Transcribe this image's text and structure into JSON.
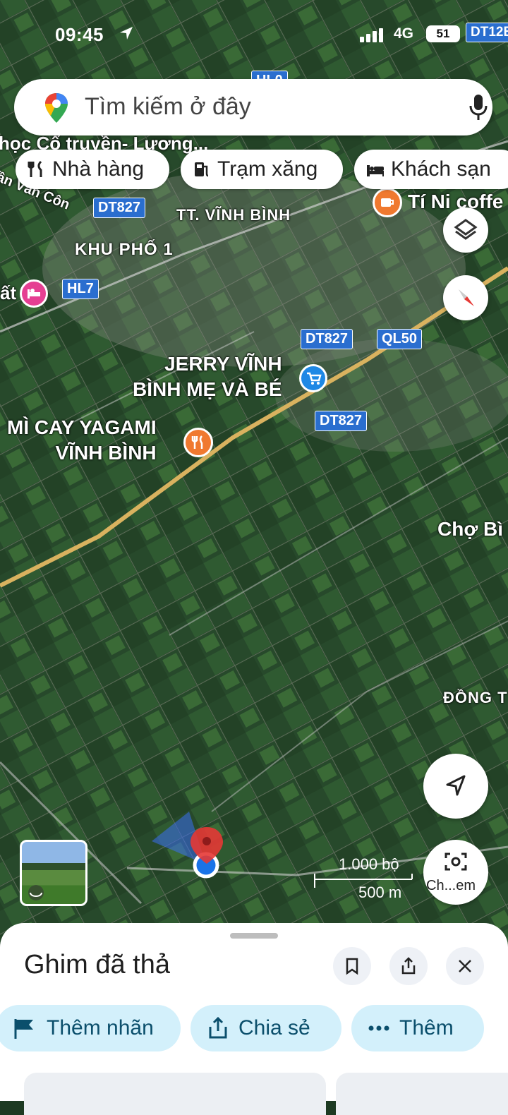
{
  "status_bar": {
    "time": "09:45",
    "network": "4G",
    "battery": "51",
    "road_tag": "DT12B"
  },
  "search": {
    "placeholder": "Tìm kiếm ở đây"
  },
  "chips": [
    {
      "label": "Nhà hàng",
      "icon": "fork-knife-icon"
    },
    {
      "label": "Trạm xăng",
      "icon": "gas-station-icon"
    },
    {
      "label": "Khách sạn",
      "icon": "bed-icon"
    }
  ],
  "map": {
    "place_labels": {
      "top_cut": "học Cổ truyền- Lương...",
      "van_con": "ần Văn Côn",
      "vinh_binh": "TT. VĨNH BÌNH",
      "khu_pho": "KHU PHỐ 1",
      "left_cut": "ất",
      "jerry": "JERRY VĨNH\nBÌNH MẸ VÀ BÉ",
      "micay": "MÌ CAY YAGAMI\nVĨNH BÌNH",
      "cho": "Chợ Bì",
      "dong": "ĐỒNG T",
      "coffee": "Tí Ni coffe"
    },
    "road_shields": {
      "hl0": "HL0",
      "dt827_a": "DT827",
      "hl7": "HL7",
      "dt827_b": "DT827",
      "ql50": "QL50",
      "dt827_c": "DT827"
    },
    "scale": {
      "top": "1.000 bộ",
      "bottom": "500 m"
    },
    "camera_label": "Ch...em"
  },
  "sheet": {
    "title": "Ghim đã thả",
    "actions": [
      {
        "label": "Thêm nhãn",
        "icon": "flag-icon"
      },
      {
        "label": "Chia sẻ",
        "icon": "share-icon"
      },
      {
        "label": "Thêm",
        "icon": "more-dots-icon"
      }
    ]
  },
  "colors": {
    "accent": "#1a73e8",
    "pin": "#e53935",
    "pill_bg": "#d3f0fb",
    "pill_text": "#0b4f6c"
  }
}
